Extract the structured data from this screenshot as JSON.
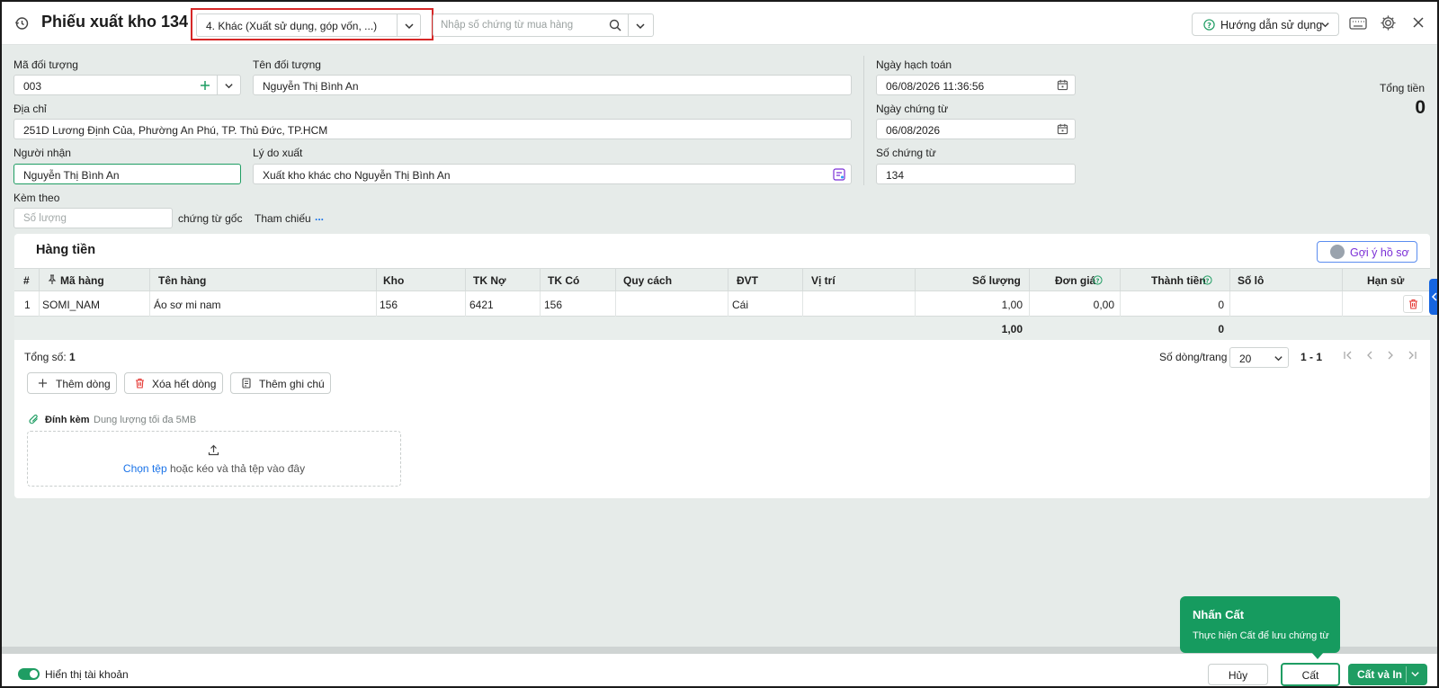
{
  "header": {
    "title": "Phiếu xuất kho 134",
    "type_value": "4. Khác (Xuất sử dụng, góp vốn, ...)",
    "search_placeholder": "Nhập số chứng từ mua hàng",
    "guide_label": "Hướng dẫn sử dụng"
  },
  "form": {
    "ma_doi_tuong": {
      "label": "Mã đối tượng",
      "value": "003"
    },
    "ten_doi_tuong": {
      "label": "Tên đối tượng",
      "value": "Nguyễn Thị Bình An"
    },
    "dia_chi": {
      "label": "Địa chỉ",
      "value": "251D Lương Định Của, Phường An Phú, TP. Thủ Đức, TP.HCM"
    },
    "nguoi_nhan": {
      "label": "Người nhận",
      "value": "Nguyễn Thị Bình An"
    },
    "ly_do_xuat": {
      "label": "Lý do xuất",
      "value": "Xuất kho khác cho Nguyễn Thị Bình An"
    },
    "kem_theo": {
      "label": "Kèm theo",
      "placeholder": "Số lượng",
      "suffix": "chứng từ gốc"
    },
    "tham_chieu": {
      "label": "Tham chiếu",
      "link": "..."
    },
    "ngay_hach_toan": {
      "label": "Ngày hạch toán",
      "value": "06/08/2026 11:36:56"
    },
    "ngay_chung_tu": {
      "label": "Ngày chứng từ",
      "value": "06/08/2026"
    },
    "so_chung_tu": {
      "label": "Số chứng từ",
      "value": "134"
    },
    "tong_tien": {
      "label": "Tổng tiền",
      "value": "0"
    }
  },
  "grid": {
    "title": "Hàng tiền",
    "suggest_label": "Gợi ý hồ sơ",
    "columns": [
      "#",
      "Mã hàng",
      "Tên hàng",
      "Kho",
      "TK Nợ",
      "TK Có",
      "Quy cách",
      "ĐVT",
      "Vị trí",
      "Số lượng",
      "Đơn giá",
      "Thành tiền",
      "Số lô",
      "Hạn sử"
    ],
    "rows": [
      [
        "1",
        "SOMI_NAM",
        "Áo sơ mi nam",
        "156",
        "6421",
        "156",
        "",
        "Cái",
        "",
        "1,00",
        "0,00",
        "0",
        "",
        ""
      ]
    ],
    "totals": {
      "so_luong": "1,00",
      "thanh_tien": "0"
    },
    "count_label": "Tổng số:",
    "count_value": "1",
    "per_page_label": "Số dòng/trang",
    "per_page_value": "20",
    "range": "1 - 1",
    "add_row": "Thêm dòng",
    "delete_all": "Xóa hết dòng",
    "add_note": "Thêm ghi chú"
  },
  "attachment": {
    "label": "Đính kèm",
    "limit": "Dung lượng tối đa 5MB",
    "choose": "Chọn tệp",
    "drop_text": " hoặc kéo và thả tệp vào đây"
  },
  "footer": {
    "toggle_label": "Hiển thị tài khoản",
    "cancel": "Hủy",
    "save": "Cất",
    "save_print": "Cất và In"
  },
  "tooltip": {
    "title": "Nhấn Cất",
    "body": "Thực hiện Cất để lưu chứng từ"
  },
  "colors": {
    "accent_green": "#1f9d63",
    "highlight_red": "#d62828",
    "link_blue": "#1a73e8",
    "suggest_purple": "#7b2fd6"
  }
}
